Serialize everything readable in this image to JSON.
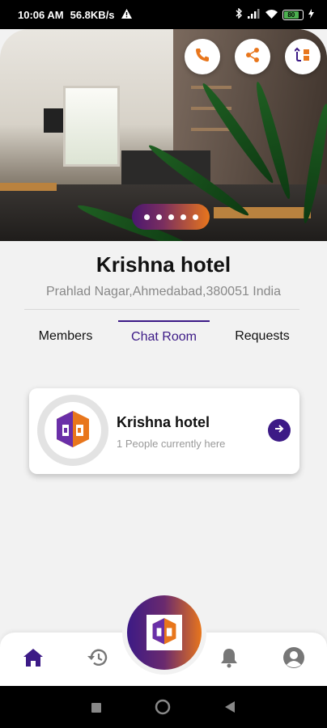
{
  "status_bar": {
    "time": "10:06 AM",
    "network_speed": "56.8KB/s",
    "battery_level": "80",
    "icons": [
      "warning-icon",
      "bluetooth-icon",
      "signal-icon",
      "wifi-icon",
      "battery-icon",
      "charging-icon"
    ]
  },
  "hero": {
    "actions": [
      {
        "name": "call",
        "icon": "phone-icon"
      },
      {
        "name": "share",
        "icon": "share-icon"
      },
      {
        "name": "switch",
        "icon": "switch-icon"
      }
    ],
    "carousel_dots": 5,
    "colors": {
      "pill_start": "#4a1770",
      "pill_end": "#e8761c"
    }
  },
  "hotel": {
    "name": "Krishna hotel",
    "address": "Prahlad Nagar,Ahmedabad,380051 India"
  },
  "tabs": [
    {
      "label": "Members",
      "active": false
    },
    {
      "label": "Chat Room",
      "active": true
    },
    {
      "label": "Requests",
      "active": false
    }
  ],
  "chat_room_card": {
    "title": "Krishna hotel",
    "subtitle": "1 People currently here"
  },
  "bottom_nav": {
    "items": [
      "home-icon",
      "history-icon",
      "bell-icon",
      "profile-icon"
    ],
    "accent": "#3c1a86"
  },
  "colors": {
    "primary": "#3c1a86",
    "orange": "#e8761c"
  }
}
